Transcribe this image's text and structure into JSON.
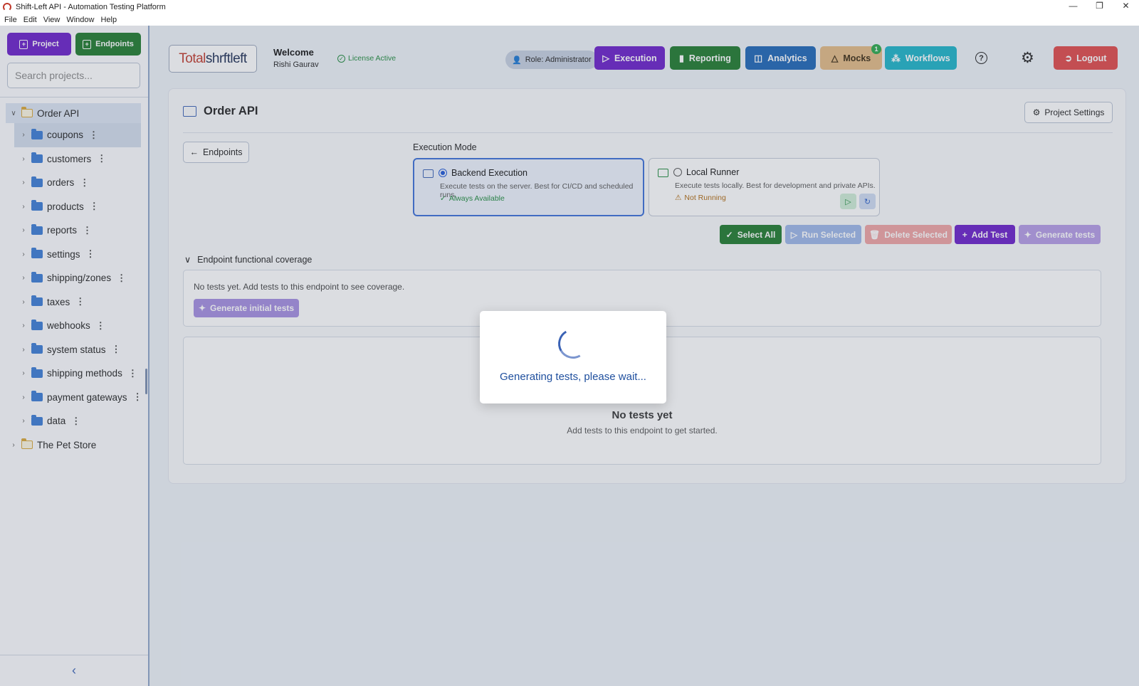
{
  "window": {
    "title": "Shift-Left API - Automation Testing Platform",
    "controls": [
      "—",
      "❐",
      "✕"
    ]
  },
  "menu": [
    "File",
    "Edit",
    "View",
    "Window",
    "Help"
  ],
  "sidebar": {
    "project_button": "Project",
    "endpoints_button": "Endpoints",
    "search_placeholder": "Search projects...",
    "tree": [
      {
        "label": "Order API",
        "kind": "root",
        "expanded": true,
        "selected": true
      },
      {
        "label": "coupons",
        "kind": "child",
        "selected": true
      },
      {
        "label": "customers",
        "kind": "child"
      },
      {
        "label": "orders",
        "kind": "child"
      },
      {
        "label": "products",
        "kind": "child"
      },
      {
        "label": "reports",
        "kind": "child"
      },
      {
        "label": "settings",
        "kind": "child"
      },
      {
        "label": "shipping/zones",
        "kind": "child"
      },
      {
        "label": "taxes",
        "kind": "child"
      },
      {
        "label": "webhooks",
        "kind": "child"
      },
      {
        "label": "system status",
        "kind": "child"
      },
      {
        "label": "shipping methods",
        "kind": "child"
      },
      {
        "label": "payment gateways",
        "kind": "child"
      },
      {
        "label": "data",
        "kind": "child"
      },
      {
        "label": "The Pet Store",
        "kind": "root",
        "expanded": false
      }
    ]
  },
  "header": {
    "logo_part1": "Total",
    "logo_part2": "shrftleft",
    "welcome": "Welcome",
    "user": "Rishi Gaurav",
    "license": "License Active",
    "role": "Role: Administrator",
    "nav": {
      "execution": "Execution",
      "reporting": "Reporting",
      "analytics": "Analytics",
      "mocks": "Mocks",
      "mocks_badge": "1",
      "workflows": "Workflows"
    },
    "logout": "Logout"
  },
  "card": {
    "title": "Order API",
    "project_settings": "Project Settings",
    "back_button": "Endpoints",
    "execution_mode_label": "Execution Mode",
    "backend": {
      "title": "Backend Execution",
      "desc": "Execute tests on the server. Best for CI/CD and scheduled runs.",
      "status": "Always Available",
      "selected": true
    },
    "local": {
      "title": "Local Runner",
      "desc": "Execute tests locally. Best for development and private APIs.",
      "status": "Not Running",
      "selected": false
    },
    "actions": {
      "select_all": "Select All",
      "run_selected": "Run Selected",
      "delete_selected": "Delete Selected",
      "add_test": "Add Test",
      "generate_tests": "Generate tests"
    },
    "coverage": {
      "heading": "Endpoint functional coverage",
      "empty_text": "No tests yet. Add tests to this endpoint to see coverage.",
      "generate_initial": "Generate initial tests"
    },
    "tests": {
      "empty_title": "No tests yet",
      "empty_sub": "Add tests to this endpoint to get started."
    }
  },
  "modal": {
    "message": "Generating tests, please wait..."
  },
  "colors": {
    "purple": "#6a1ec9",
    "green": "#1e7a2c",
    "blue": "#1d66b6",
    "mocks": "#e3ba84",
    "teal": "#1bb4c8",
    "red": "#e04848"
  }
}
